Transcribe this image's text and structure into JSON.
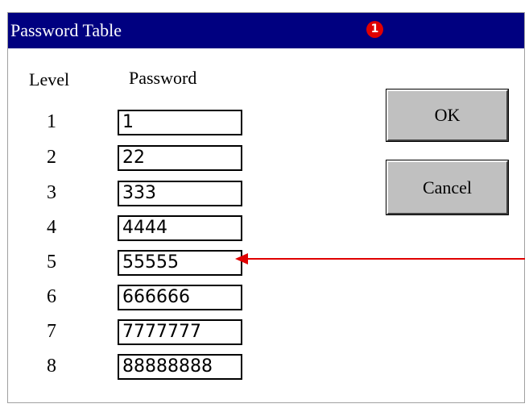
{
  "dialog": {
    "title": "Password Table",
    "marker": "1"
  },
  "table": {
    "level_header": "Level",
    "password_header": "Password",
    "rows": [
      {
        "level": "1",
        "password": "1"
      },
      {
        "level": "2",
        "password": "22"
      },
      {
        "level": "3",
        "password": "333"
      },
      {
        "level": "4",
        "password": "4444"
      },
      {
        "level": "5",
        "password": "55555"
      },
      {
        "level": "6",
        "password": "666666"
      },
      {
        "level": "7",
        "password": "7777777"
      },
      {
        "level": "8",
        "password": "88888888"
      }
    ]
  },
  "buttons": {
    "ok": "OK",
    "cancel": "Cancel"
  },
  "colors": {
    "titlebar": "#000080",
    "marker": "#e00000",
    "arrow": "#e00000",
    "button_face": "#c0c0c0"
  }
}
